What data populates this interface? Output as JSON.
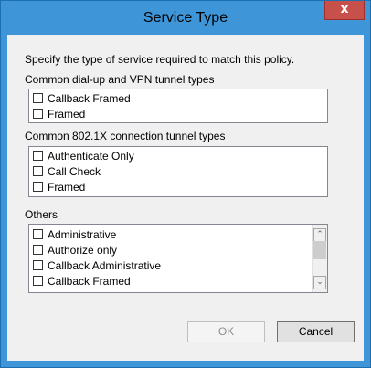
{
  "dialog": {
    "title": "Service Type",
    "close_glyph": "x",
    "description": "Specify the type of service required to match this policy."
  },
  "groups": {
    "dialup": {
      "label": "Common dial-up and VPN tunnel types",
      "items": [
        {
          "label": "Callback Framed",
          "checked": false
        },
        {
          "label": "Framed",
          "checked": false
        }
      ]
    },
    "dot1x": {
      "label": "Common 802.1X connection tunnel types",
      "items": [
        {
          "label": "Authenticate Only",
          "checked": false
        },
        {
          "label": "Call Check",
          "checked": false
        },
        {
          "label": "Framed",
          "checked": false
        }
      ]
    },
    "others": {
      "label": "Others",
      "items": [
        {
          "label": "Administrative",
          "checked": false
        },
        {
          "label": "Authorize only",
          "checked": false
        },
        {
          "label": "Callback Administrative",
          "checked": false
        },
        {
          "label": "Callback Framed",
          "checked": false
        }
      ],
      "scroll_up_glyph": "⌃",
      "scroll_down_glyph": "⌄"
    }
  },
  "buttons": {
    "ok": "OK",
    "cancel": "Cancel",
    "ok_enabled": false
  },
  "colors": {
    "titlebar": "#3e95d8",
    "close": "#c7504b",
    "client": "#f0f0f0"
  }
}
